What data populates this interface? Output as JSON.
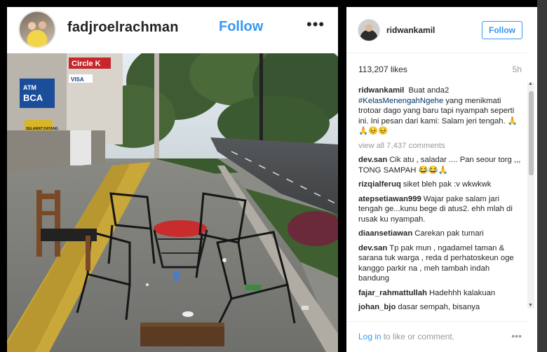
{
  "post": {
    "username": "fadjroelrachman",
    "follow_label": "Follow",
    "more_icon": "•••",
    "photo_signs": {
      "circle_k": "Circle K",
      "atm": "ATM",
      "bca": "BCA",
      "visa": "VISA",
      "kedai": "SELAMAT DATANG"
    }
  },
  "panel": {
    "username": "ridwankamil",
    "follow_label": "Follow",
    "likes": "113,207 likes",
    "time": "5h",
    "caption_user": "ridwankamil",
    "caption_lead": "Buat anda2",
    "caption_tag": "#KelasMenengahNgehe",
    "caption_body": "yang menikmati trotoar dago yang baru tapi nyampah seperti ini. Ini pesan dari kami: Salam jeri tengah. 🙏🙏😣😣",
    "view_all": "view all 7,437 comments",
    "comments": [
      {
        "user": "dev.san",
        "text": "Cik atu , saladar .... Pan seour torg ,,, TONG SAMPAH 😂😂🙏"
      },
      {
        "user": "rizqialferuq",
        "text": "siket bleh pak :v wkwkwk"
      },
      {
        "user": "atepsetiawan999",
        "text": "Wajar pake salam jari tengah ge...kunu bege di atus2. ehh mlah di rusak ku nyampah."
      },
      {
        "user": "diaansetiawan",
        "text": "Carekan pak tumari"
      },
      {
        "user": "dev.san",
        "text": "Tp pak mun , ngadamel taman & sarana tuk warga , reda d perhatoskeun oge kanggo parkir na , meh tambah indah bandung"
      },
      {
        "user": "fajar_rahmattullah",
        "text": "Hadehhh kalakuan"
      },
      {
        "user": "johan_bjo",
        "text": "dasar sempah, bisanya"
      }
    ],
    "login_link": "Log in",
    "login_text": "to like or comment.",
    "more_icon": "•••"
  }
}
